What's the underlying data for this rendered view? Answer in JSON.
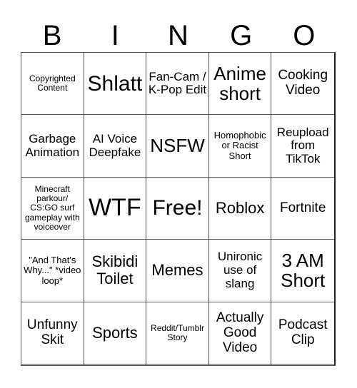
{
  "header": {
    "letters": [
      "B",
      "I",
      "N",
      "G",
      "O"
    ]
  },
  "cells": [
    "Copyrighted Content",
    "Shlatt",
    "Fan-Cam / K-Pop Edit",
    "Anime short",
    "Cooking Video",
    "Garbage Animation",
    "AI Voice Deepfake",
    "NSFW",
    "Homophobic or Racist Short",
    "Reupload from TikTok",
    "Minecraft parkour/ CS:GO surf gameplay with voiceover",
    "WTF",
    "Free!",
    "Roblox",
    "Fortnite",
    "\"And That's Why...\" *video loop*",
    "Skibidi Toilet",
    "Memes",
    "Unironic use of slang",
    "3 AM Short",
    "Unfunny Skit",
    "Sports",
    "Reddit/Tumblr Story",
    "Actually Good Video",
    "Podcast Clip"
  ]
}
